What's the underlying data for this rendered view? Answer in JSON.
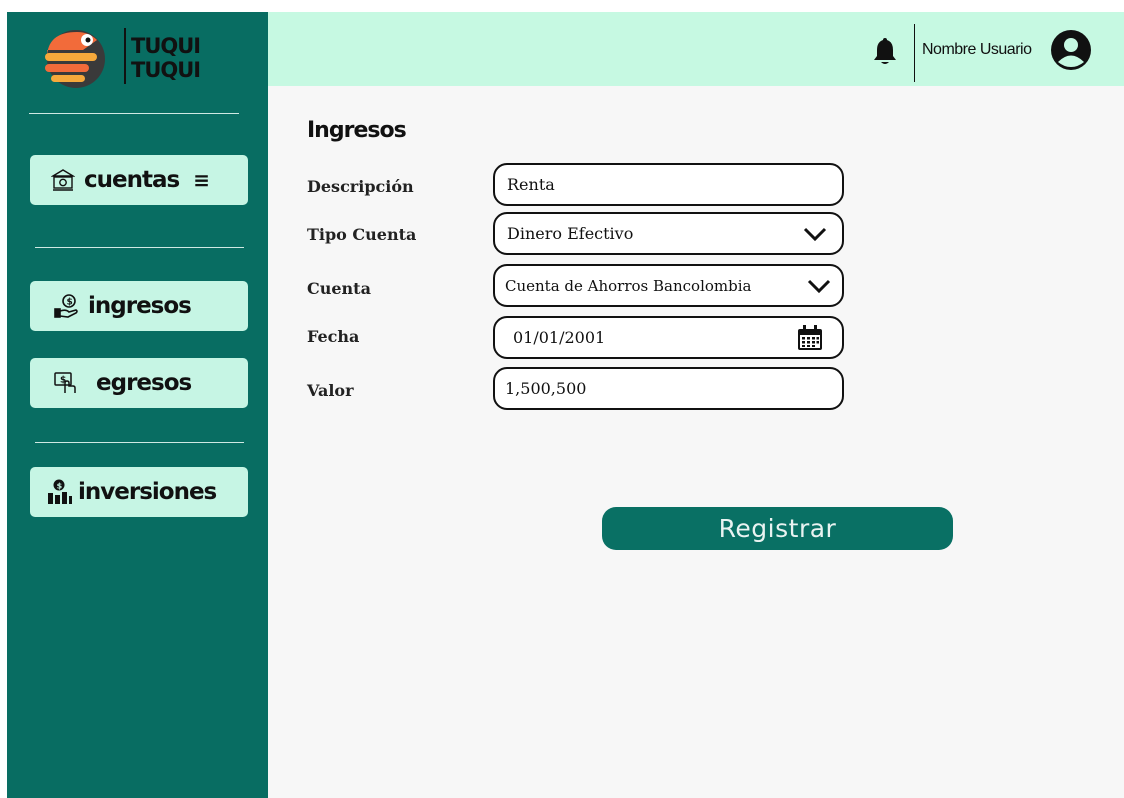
{
  "app": {
    "brand_line1": "TUQUI",
    "brand_line2": "TUQUI"
  },
  "sidebar": {
    "items": [
      {
        "label": "cuentas",
        "icon": "bank-icon",
        "trailing": "≡"
      },
      {
        "label": "ingresos",
        "icon": "hand-coin-icon"
      },
      {
        "label": "egresos",
        "icon": "pay-cash-icon"
      },
      {
        "label": "inversiones",
        "icon": "investment-chart-icon"
      }
    ]
  },
  "header": {
    "user_name": "Nombre Usuario",
    "icons": [
      "bell-icon",
      "user-avatar-icon"
    ]
  },
  "form": {
    "title": "Ingresos",
    "fields": {
      "descripcion": {
        "label": "Descripción",
        "value": "Renta"
      },
      "tipo_cuenta": {
        "label": "Tipo Cuenta",
        "value": "Dinero Efectivo"
      },
      "cuenta": {
        "label": "Cuenta",
        "value": "Cuenta de Ahorros Bancolombia"
      },
      "fecha": {
        "label": "Fecha",
        "value": "01/01/2001"
      },
      "valor": {
        "label": "Valor",
        "value": "1,500,500"
      }
    },
    "submit_label": "Registrar"
  },
  "colors": {
    "sidebar": "#086d62",
    "header": "#c6f9e2",
    "nav_button": "#c6f5e4",
    "primary_button": "#097064",
    "content_bg": "#f7f7f7"
  }
}
